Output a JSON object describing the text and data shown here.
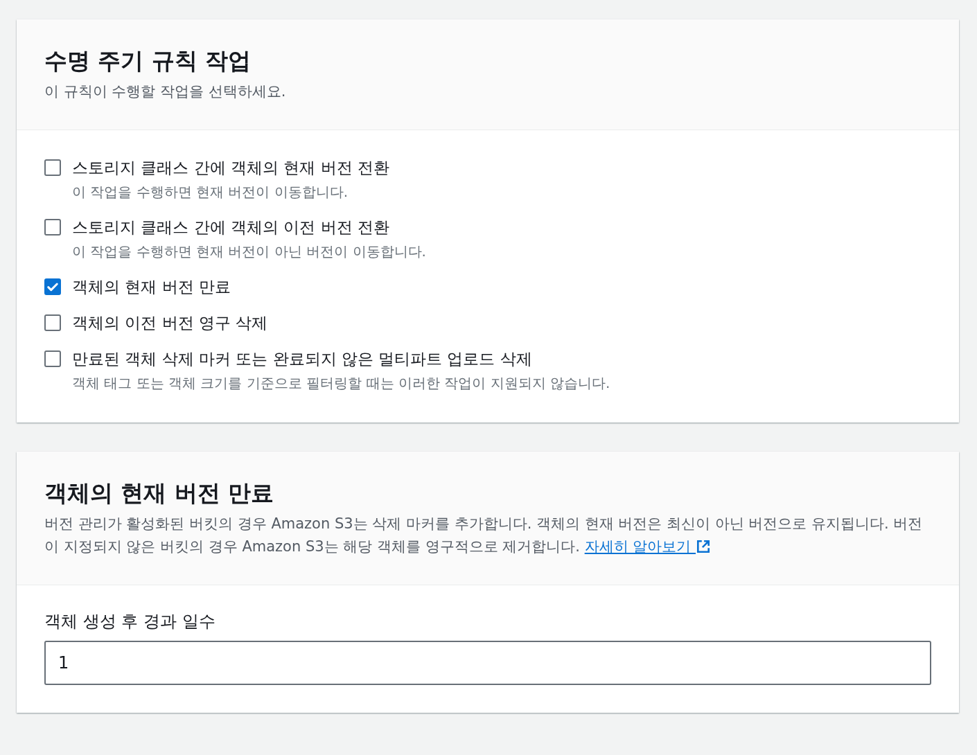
{
  "actions_panel": {
    "title": "수명 주기 규칙 작업",
    "description": "이 규칙이 수행할 작업을 선택하세요.",
    "options": [
      {
        "label": "스토리지 클래스 간에 객체의 현재 버전 전환",
        "hint": "이 작업을 수행하면 현재 버전이 이동합니다.",
        "checked": false
      },
      {
        "label": "스토리지 클래스 간에 객체의 이전 버전 전환",
        "hint": "이 작업을 수행하면 현재 버전이 아닌 버전이 이동합니다.",
        "checked": false
      },
      {
        "label": "객체의 현재 버전 만료",
        "checked": true
      },
      {
        "label": "객체의 이전 버전 영구 삭제",
        "checked": false
      },
      {
        "label": "만료된 객체 삭제 마커 또는 완료되지 않은 멀티파트 업로드 삭제",
        "hint": "객체 태그 또는 객체 크기를 기준으로 필터링할 때는 이러한 작업이 지원되지 않습니다.",
        "checked": false
      }
    ]
  },
  "expiration_panel": {
    "title": "객체의 현재 버전 만료",
    "description": "버전 관리가 활성화된 버킷의 경우 Amazon S3는 삭제 마커를 추가합니다. 객체의 현재 버전은 최신이 아닌 버전으로 유지됩니다. 버전이 지정되지 않은 버킷의 경우 Amazon S3는 해당 객체를 영구적으로 제거합니다.",
    "link": "자세히 알아보기",
    "field": {
      "label": "객체 생성 후 경과 일수",
      "value": "1"
    }
  }
}
